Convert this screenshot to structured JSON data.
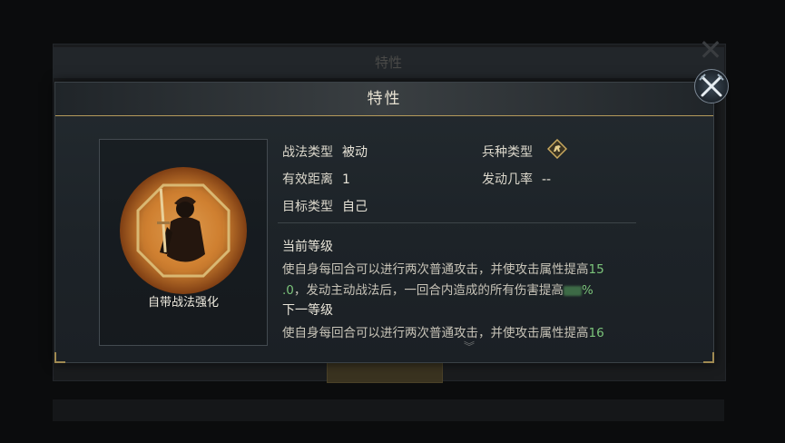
{
  "background": {
    "title": "特性"
  },
  "dialog": {
    "title": "特性",
    "skill_name": "自带战法强化",
    "fields": {
      "tactic_type_label": "战法类型",
      "tactic_type_value": "被动",
      "range_label": "有效距离",
      "range_value": "1",
      "target_label": "目标类型",
      "target_value": "自己",
      "troop_type_label": "兵种类型",
      "trigger_rate_label": "发动几率",
      "trigger_rate_value": "--"
    },
    "current_level": {
      "title": "当前等级",
      "line1_text": "使自身每回合可以进行两次普通攻击，并使攻击属性提高",
      "line1_num": "15",
      "line2_num": ".0",
      "line2_text": "，发动主动战法后，一回合内造成的所有伤害提高",
      "line2_suffix": "%"
    },
    "next_level": {
      "title": "下一等级",
      "line1_text": "使自身每回合可以进行两次普通攻击，并使攻击属性提高",
      "line1_num": "16"
    }
  },
  "icons": {
    "close": "close-crossed-swords-icon",
    "troop": "cavalry-horse-icon",
    "scroll": "chevron-down-icon"
  },
  "colors": {
    "accent_gold": "#b59a5b",
    "number_green": "#7bc47a"
  }
}
